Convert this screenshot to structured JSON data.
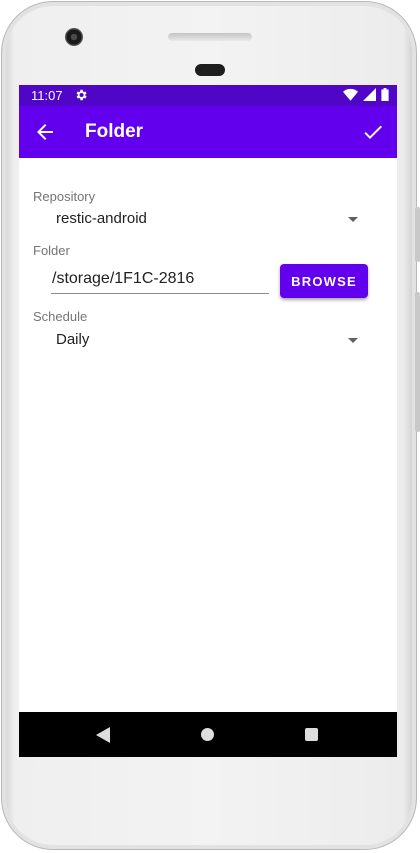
{
  "status_bar": {
    "time": "11:07"
  },
  "app_bar": {
    "title": "Folder"
  },
  "form": {
    "repository": {
      "label": "Repository",
      "value": "restic-android"
    },
    "folder": {
      "label": "Folder",
      "value": "/storage/1F1C-2816",
      "browse_label": "BROWSE"
    },
    "schedule": {
      "label": "Schedule",
      "value": "Daily"
    }
  },
  "colors": {
    "primary": "#6200ee",
    "primary_dark": "#4f06c7",
    "nav_bar": "#000000"
  },
  "icons": {
    "status": [
      "settings-icon",
      "wifi-icon",
      "signal-icon",
      "battery-icon"
    ],
    "app_bar": [
      "back-arrow-icon",
      "checkmark-icon"
    ],
    "nav": [
      "nav-back-icon",
      "nav-home-icon",
      "nav-recents-icon"
    ]
  }
}
